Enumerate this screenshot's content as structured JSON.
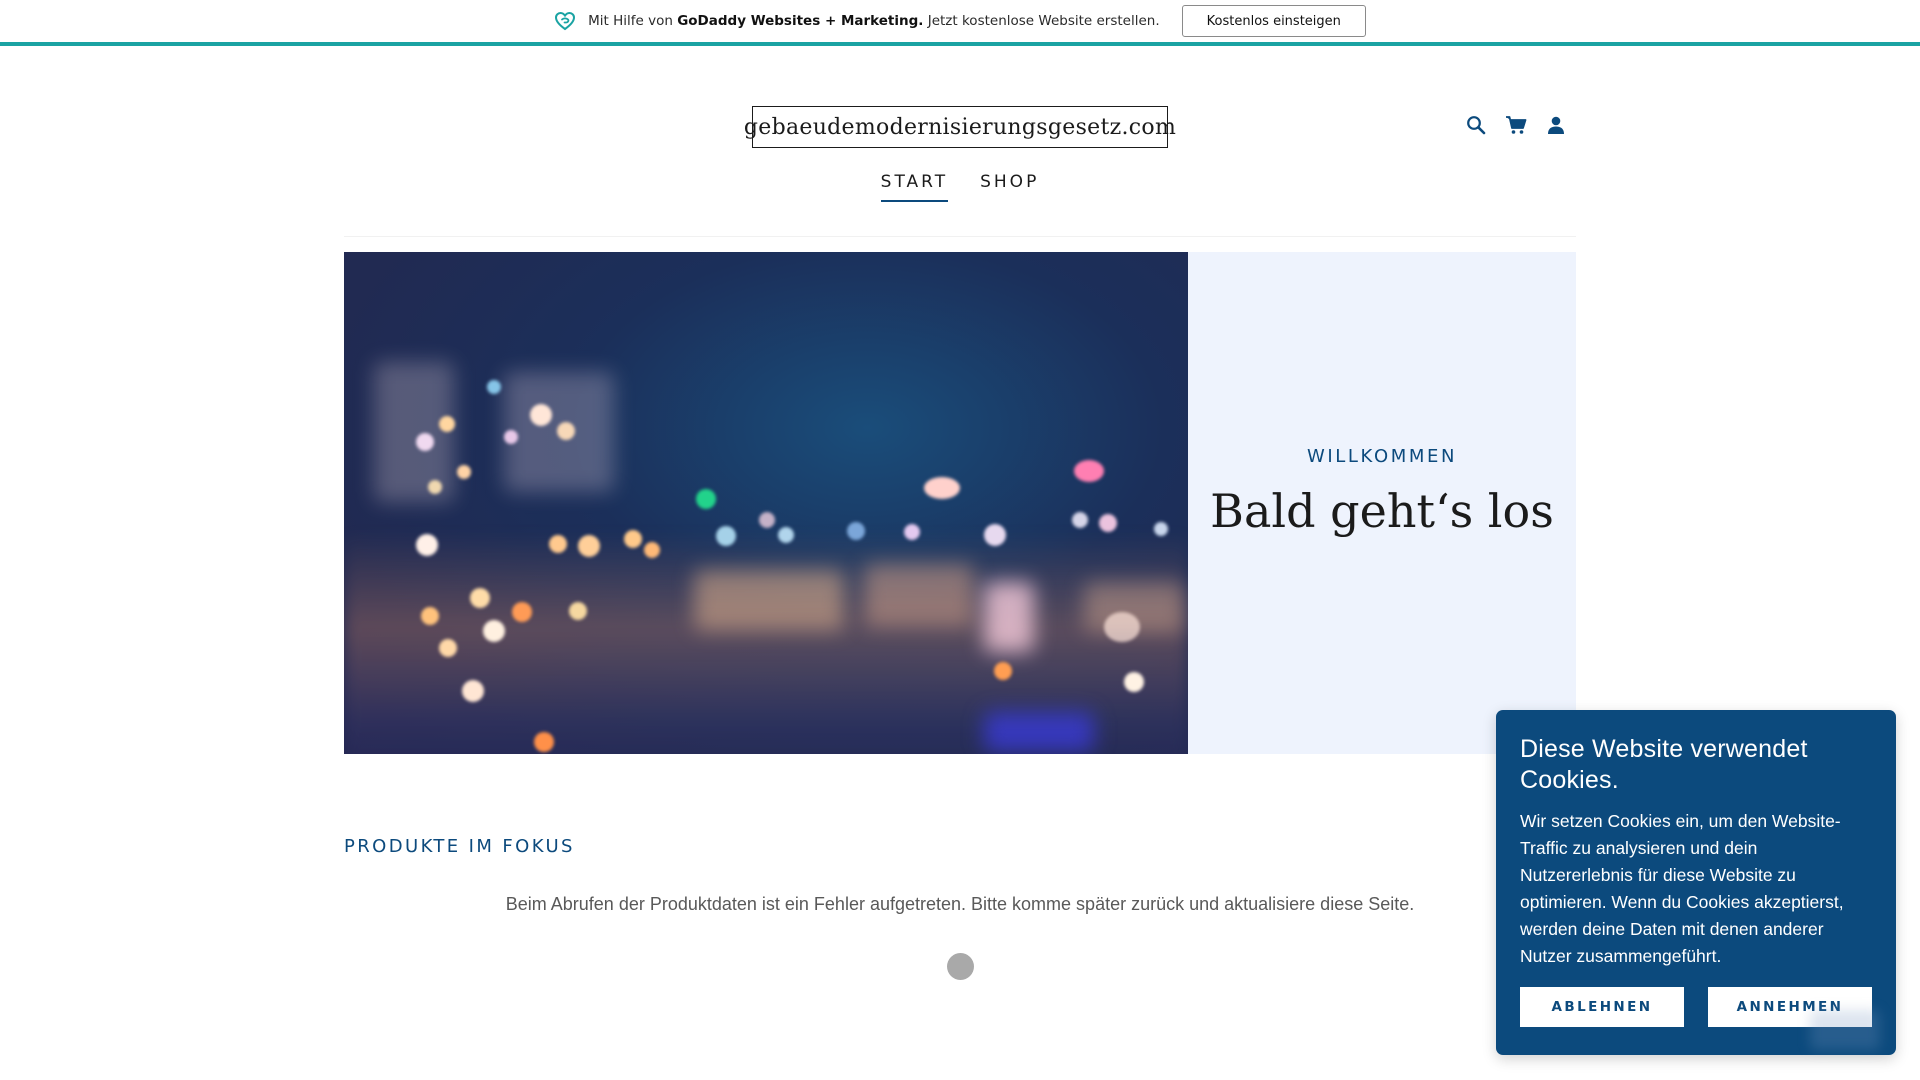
{
  "promo_bar": {
    "prefix": "Mit Hilfe von",
    "brand": "GoDaddy Websites + Marketing.",
    "suffix": "Jetzt kostenlose Website erstellen.",
    "cta_label": "Kostenlos einsteigen",
    "icon": "godaddy-heart-icon",
    "accent_color": "#1aa3a3"
  },
  "header": {
    "site_title": "gebaeudemodernisierungsgesetz.com",
    "utility_icons": [
      "search-icon",
      "cart-icon",
      "account-icon"
    ],
    "nav": [
      {
        "label": "START",
        "active": true
      },
      {
        "label": "SHOP",
        "active": false
      }
    ]
  },
  "hero": {
    "eyebrow": "WILLKOMMEN",
    "title": "Bald geht‘s los",
    "panel_color": "#eef3fd"
  },
  "products": {
    "section_title": "PRODUKTE IM FOKUS",
    "error_message": "Beim Abrufen der Produktdaten ist ein Fehler aufgetreten. Bitte komme später zurück und aktualisiere diese Seite."
  },
  "cookie_banner": {
    "title": "Diese Website verwendet Cookies.",
    "body": "Wir setzen Cookies ein, um den Website-Traffic zu analysieren und dein Nutzererlebnis für diese Website zu optimieren. Wenn du Cookies akzeptierst, werden deine Daten mit denen anderer Nutzer zusammengeführt.",
    "decline_label": "ABLEHNEN",
    "accept_label": "ANNEHMEN",
    "background_color": "#0c4a7d"
  },
  "colors": {
    "brand_blue": "#0c4a7d",
    "text_dark": "#1b1b1b",
    "muted_text": "#595959"
  }
}
